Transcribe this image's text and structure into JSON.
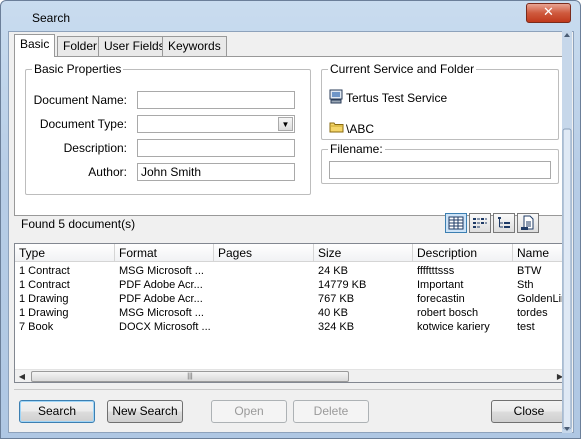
{
  "window": {
    "title": "Search"
  },
  "tabs": [
    {
      "label": "Basic",
      "active": true
    },
    {
      "label": "Folder",
      "active": false
    },
    {
      "label": "User Fields",
      "active": false
    },
    {
      "label": "Keywords",
      "active": false
    }
  ],
  "basic_properties": {
    "legend": "Basic Properties",
    "document_name_label": "Document Name:",
    "document_name_value": "",
    "document_type_label": "Document Type:",
    "document_type_value": "",
    "description_label": "Description:",
    "description_value": "",
    "author_label": "Author:",
    "author_value": "John Smith"
  },
  "service": {
    "legend": "Current Service and Folder",
    "service_name": "Tertus Test Service",
    "folder": "\\ABC"
  },
  "filename": {
    "legend": "Filename:",
    "value": ""
  },
  "results": {
    "status": "Found 5 document(s)"
  },
  "list": {
    "columns": [
      "Type",
      "Format",
      "Pages",
      "Size",
      "Description",
      "Name"
    ],
    "rows": [
      [
        "1 Contract",
        "MSG Microsoft ...",
        "",
        "24 KB",
        "fffftttsss",
        "BTW"
      ],
      [
        "1 Contract",
        "PDF Adobe Acr...",
        "",
        "14779 KB",
        "Important",
        "Sth"
      ],
      [
        "1 Drawing",
        "PDF Adobe Acr...",
        "",
        "767 KB",
        "forecastin",
        "GoldenLine"
      ],
      [
        "1 Drawing",
        "MSG Microsoft ...",
        "",
        "40 KB",
        "robert bosch",
        "tordes"
      ],
      [
        "7 Book",
        "DOCX Microsoft ...",
        "",
        "324 KB",
        "kotwice kariery",
        "test"
      ]
    ]
  },
  "buttons": {
    "search": "Search",
    "new_search": "New Search",
    "open": "Open",
    "delete": "Delete",
    "close": "Close"
  },
  "icons": {
    "close": "close-icon",
    "service": "computer-icon",
    "folder": "folder-icon",
    "views": [
      "details-view-icon",
      "list-view-icon",
      "tree-view-icon",
      "preview-view-icon"
    ]
  },
  "colors": {
    "close_button": "#c9472b",
    "accent": "#3c7fb1",
    "window_frame": "#b7cde6"
  }
}
